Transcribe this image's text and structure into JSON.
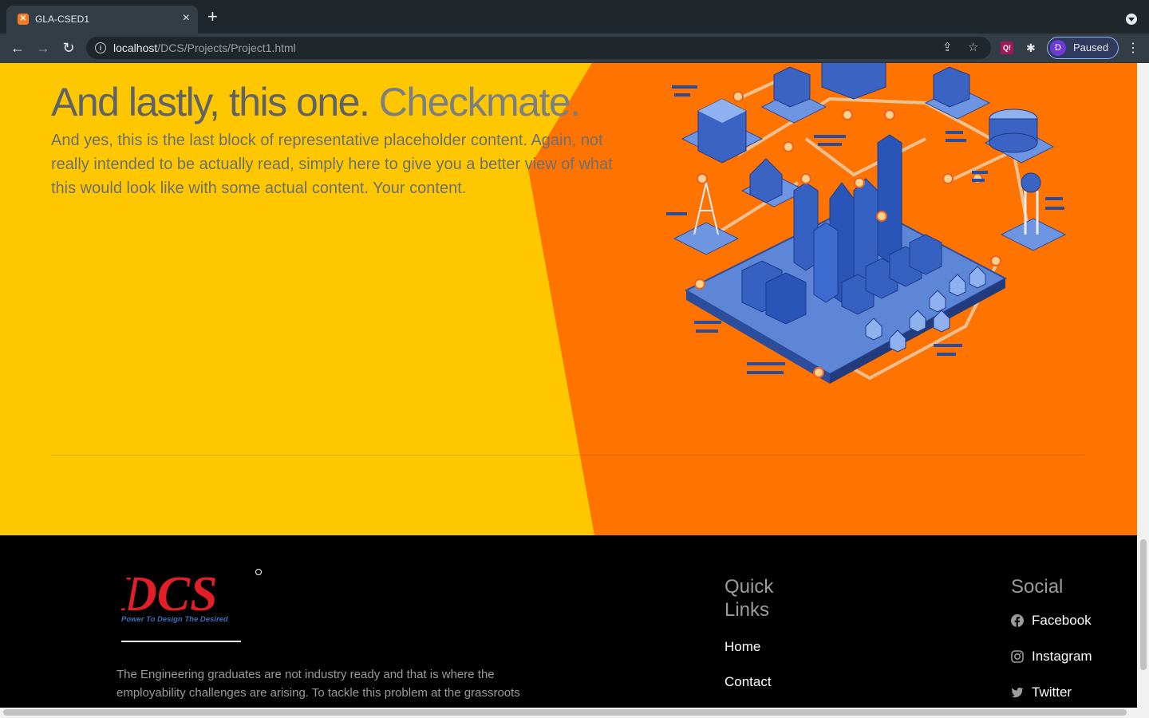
{
  "browser": {
    "tab_title": "GLA-CSED1",
    "url_host": "localhost",
    "url_path": "/DCS/Projects/Project1.html",
    "profile_initial": "D",
    "profile_status": "Paused"
  },
  "hero": {
    "heading_main": "And lastly, this one.",
    "heading_muted": "Checkmate.",
    "lead": "And yes, this is the last block of representative placeholder content. Again, not really intended to be actually read, simply here to give you a better view of what this would look like with some actual content. Your content.",
    "colors": {
      "orange": "#ff7300",
      "yellow": "#ffc700"
    }
  },
  "footer": {
    "logo_text": "DCS",
    "logo_tagline": "Power To Design The Desired",
    "about": "The Engineering graduates are not industry ready and that is where the employability challenges are arising. To tackle this problem at the grassroots",
    "quick_links": {
      "title": "Quick Links",
      "items": [
        "Home",
        "Contact"
      ]
    },
    "social": {
      "title": "Social",
      "items": [
        {
          "label": "Facebook",
          "icon": "facebook-icon"
        },
        {
          "label": "Instagram",
          "icon": "instagram-icon"
        },
        {
          "label": "Twitter",
          "icon": "twitter-icon"
        }
      ]
    }
  }
}
